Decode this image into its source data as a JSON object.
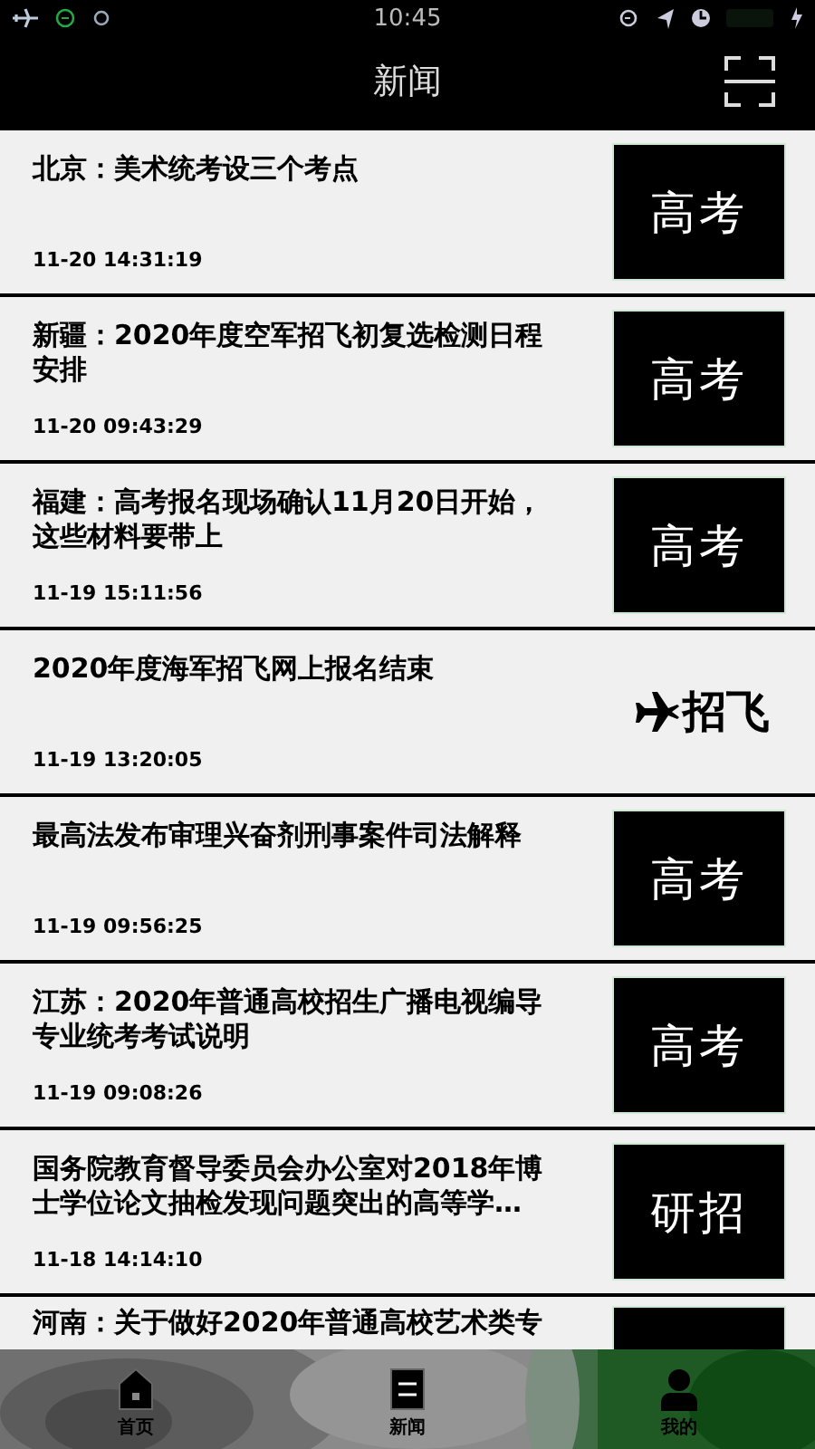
{
  "status_bar": {
    "time": "10:45"
  },
  "nav": {
    "title": "新闻"
  },
  "news": [
    {
      "title": "北京：美术统考设三个考点",
      "time": "11-20 14:31:19",
      "tag": {
        "kind": "box",
        "text": "高考"
      }
    },
    {
      "title": "新疆：2020年度空军招飞初复选检测日程安排",
      "time": "11-20 09:43:29",
      "tag": {
        "kind": "box",
        "text": "高考"
      }
    },
    {
      "title": "福建：高考报名现场确认11月20日开始，这些材料要带上",
      "time": "11-19 15:11:56",
      "tag": {
        "kind": "box",
        "text": "高考"
      }
    },
    {
      "title": "2020年度海军招飞网上报名结束",
      "time": "11-19 13:20:05",
      "tag": {
        "kind": "plane",
        "text": "招飞"
      }
    },
    {
      "title": "最高法发布审理兴奋剂刑事案件司法解释",
      "time": "11-19 09:56:25",
      "tag": {
        "kind": "box",
        "text": "高考"
      }
    },
    {
      "title": "江苏：2020年普通高校招生广播电视编导专业统考考试说明",
      "time": "11-19 09:08:26",
      "tag": {
        "kind": "box",
        "text": "高考"
      }
    },
    {
      "title": "国务院教育督导委员会办公室对2018年博士学位论文抽检发现问题突出的高等学…",
      "time": "11-18 14:14:10",
      "tag": {
        "kind": "box",
        "text": "研招"
      }
    },
    {
      "title": "河南：关于做好2020年普通高校艺术类专",
      "tag": {
        "kind": "box"
      }
    }
  ],
  "tab_bar": [
    {
      "kind": "home",
      "label": "首页"
    },
    {
      "kind": "news",
      "label": "新闻"
    },
    {
      "kind": "person",
      "label": "我的"
    }
  ]
}
